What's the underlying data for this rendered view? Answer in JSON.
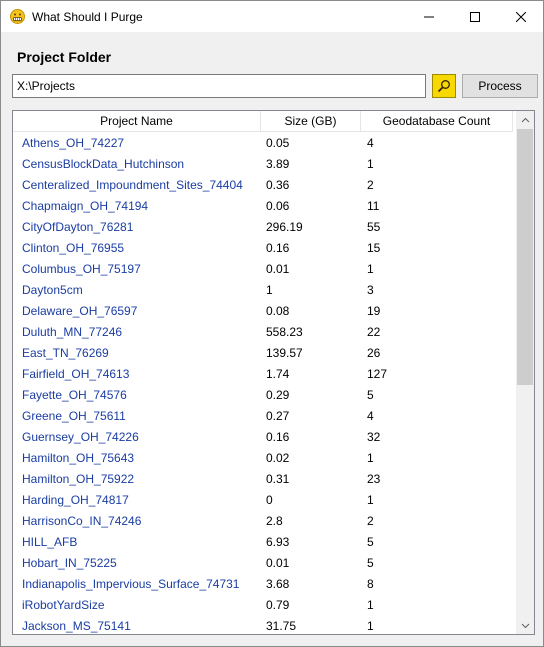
{
  "window": {
    "title": "What Should I Purge",
    "app_icon": "grimace-face-icon",
    "controls": [
      "minimize-icon",
      "maximize-icon",
      "close-icon"
    ]
  },
  "project_folder": {
    "label": "Project Folder",
    "path_value": "X:\\Projects",
    "browse_icon": "search-icon",
    "process_label": "Process"
  },
  "grid": {
    "columns": [
      "Project Name",
      "Size (GB)",
      "Geodatabase Count"
    ],
    "rows": [
      {
        "name": "Athens_OH_74227",
        "size": "0.05",
        "count": "4"
      },
      {
        "name": "CensusBlockData_Hutchinson",
        "size": "3.89",
        "count": "1"
      },
      {
        "name": "Centeralized_Impoundment_Sites_74404",
        "size": "0.36",
        "count": "2"
      },
      {
        "name": "Chapmaign_OH_74194",
        "size": "0.06",
        "count": "11"
      },
      {
        "name": "CityOfDayton_76281",
        "size": "296.19",
        "count": "55"
      },
      {
        "name": "Clinton_OH_76955",
        "size": "0.16",
        "count": "15"
      },
      {
        "name": "Columbus_OH_75197",
        "size": "0.01",
        "count": "1"
      },
      {
        "name": "Dayton5cm",
        "size": "1",
        "count": "3"
      },
      {
        "name": "Delaware_OH_76597",
        "size": "0.08",
        "count": "19"
      },
      {
        "name": "Duluth_MN_77246",
        "size": "558.23",
        "count": "22"
      },
      {
        "name": "East_TN_76269",
        "size": "139.57",
        "count": "26"
      },
      {
        "name": "Fairfield_OH_74613",
        "size": "1.74",
        "count": "127"
      },
      {
        "name": "Fayette_OH_74576",
        "size": "0.29",
        "count": "5"
      },
      {
        "name": "Greene_OH_75611",
        "size": "0.27",
        "count": "4"
      },
      {
        "name": "Guernsey_OH_74226",
        "size": "0.16",
        "count": "32"
      },
      {
        "name": "Hamilton_OH_75643",
        "size": "0.02",
        "count": "1"
      },
      {
        "name": "Hamilton_OH_75922",
        "size": "0.31",
        "count": "23"
      },
      {
        "name": "Harding_OH_74817",
        "size": "0",
        "count": "1"
      },
      {
        "name": "HarrisonCo_IN_74246",
        "size": "2.8",
        "count": "2"
      },
      {
        "name": "HILL_AFB",
        "size": "6.93",
        "count": "5"
      },
      {
        "name": "Hobart_IN_75225",
        "size": "0.01",
        "count": "5"
      },
      {
        "name": "Indianapolis_Impervious_Surface_74731",
        "size": "3.68",
        "count": "8"
      },
      {
        "name": "iRobotYardSize",
        "size": "0.79",
        "count": "1"
      },
      {
        "name": "Jackson_MS_75141",
        "size": "31.75",
        "count": "1"
      }
    ]
  },
  "colors": {
    "browse_button": "#f7d800",
    "project_name_text": "#1a3da3"
  }
}
